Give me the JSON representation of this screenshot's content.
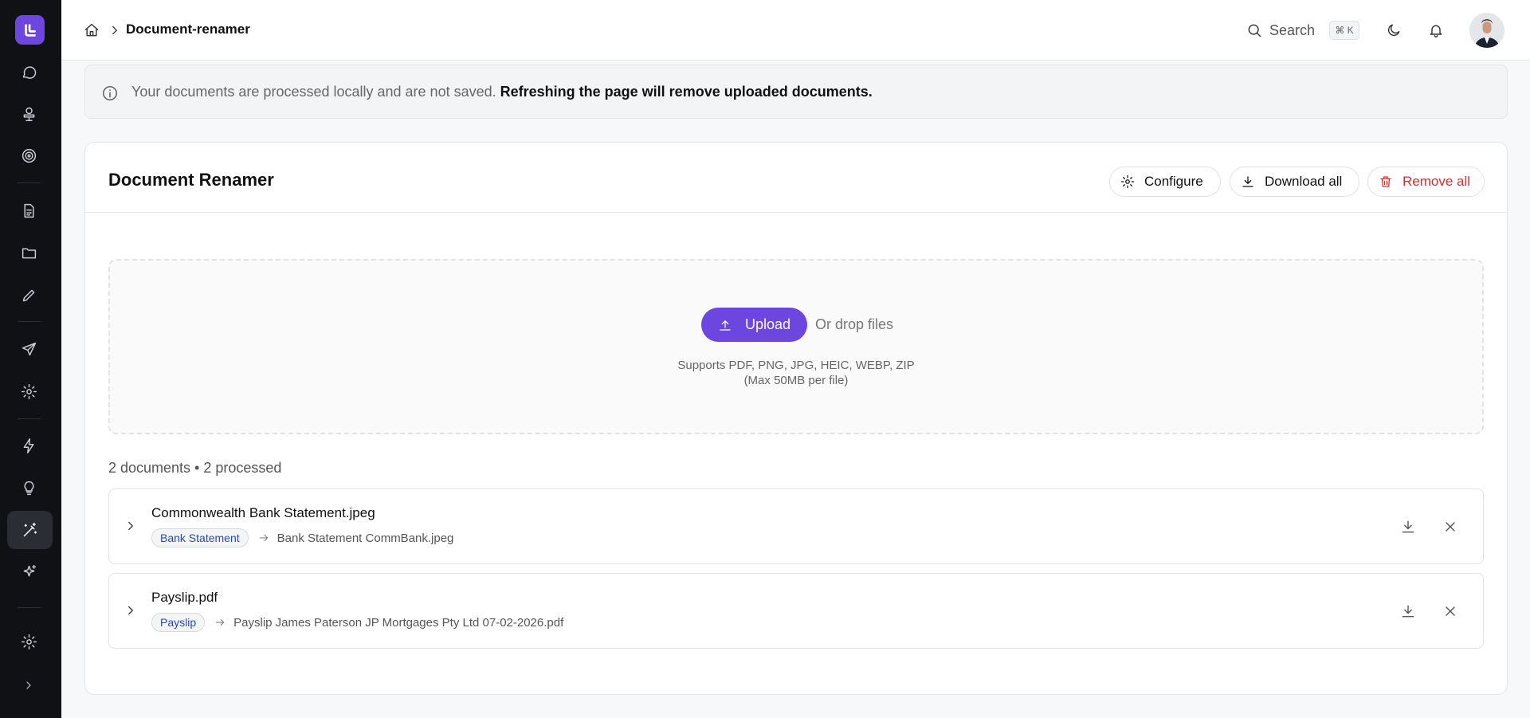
{
  "breadcrumb": {
    "current": "Document-renamer"
  },
  "header": {
    "search_label": "Search",
    "search_shortcut": "⌘ K"
  },
  "sidebar": {
    "icons": [
      "chat-icon",
      "presentation-icon",
      "target-icon",
      "document-icon",
      "folder-icon",
      "pencil-icon",
      "send-icon",
      "settings-icon",
      "lightning-icon",
      "lightbulb-icon",
      "magic-wand-icon",
      "sparkles-icon",
      "settings-icon",
      "chevron-right-icon"
    ],
    "active": "magic-wand-icon"
  },
  "info_banner": {
    "text": "Your documents are processed locally and are not saved.",
    "bold_text": "Refreshing the page will remove uploaded documents."
  },
  "card": {
    "title": "Document Renamer",
    "configure_label": "Configure",
    "download_all_label": "Download all",
    "remove_all_label": "Remove all"
  },
  "dropzone": {
    "upload_label": "Upload",
    "drop_text": "Or drop files",
    "supports_line1": "Supports PDF, PNG, JPG, HEIC, WEBP, ZIP",
    "supports_line2": "(Max 50MB per file)"
  },
  "summary": "2 documents • 2 processed",
  "documents": [
    {
      "name": "Commonwealth Bank Statement.jpeg",
      "tag": "Bank Statement",
      "new_name": "Bank Statement CommBank.jpeg"
    },
    {
      "name": "Payslip.pdf",
      "tag": "Payslip",
      "new_name": "Payslip James Paterson JP Mortgages Pty Ltd 07-02-2026.pdf"
    }
  ],
  "colors": {
    "accent": "#6d46e0",
    "danger": "#d92d2d",
    "tag_text": "#2847b8",
    "sidebar_bg": "#0f1115"
  }
}
